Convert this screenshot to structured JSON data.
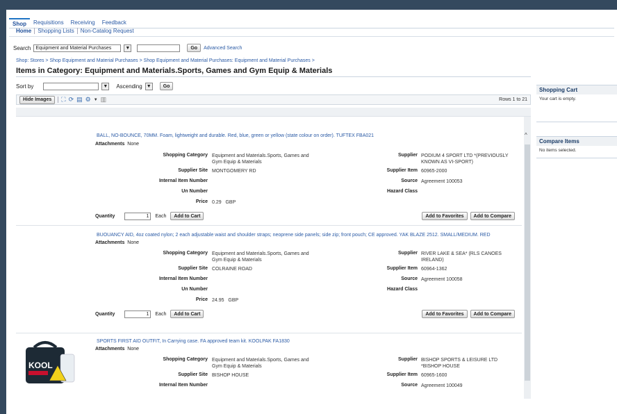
{
  "tabs": [
    "Shop",
    "Requisitions",
    "Receiving",
    "Feedback"
  ],
  "subtabs": [
    "Home",
    "Shopping Lists",
    "Non-Catalog Request"
  ],
  "search": {
    "label": "Search",
    "selected": "Equipment and Material Purchases",
    "go_label": "Go",
    "advanced_label": "Advanced Search"
  },
  "breadcrumb": "Shop: Stores  >  Shop Equipment and Material Purchases  >  Shop Equipment and Material Purchases: Equipment and Material Purchases  >",
  "page_title": "Items in Category: Equipment and Materials.Sports, Games and Gym Equip & Materials",
  "sort": {
    "label": "Sort by",
    "value": "",
    "order": "Ascending",
    "go_label": "Go"
  },
  "toolbar": {
    "hide_images_label": "Hide Images",
    "rows_label": "Rows 1 to 21"
  },
  "labels": {
    "attachments": "Attachments",
    "shopping_category": "Shopping Category",
    "supplier_site": "Supplier Site",
    "internal_item_number": "Internal Item Number",
    "un_number": "Un Number",
    "price": "Price",
    "supplier": "Supplier",
    "supplier_item": "Supplier Item",
    "source": "Source",
    "hazard_class": "Hazard Class",
    "quantity": "Quantity",
    "add_to_cart": "Add to Cart",
    "add_to_favorites": "Add to Favorites",
    "add_to_compare": "Add to Compare"
  },
  "items": [
    {
      "title": "BALL, NO-BOUNCE, 70MM. Foam, lightweight and durable. Red, blue, green or yellow (state colour on order). TUFTEX FBA021",
      "attachments": "None",
      "shopping_category": "Equipment and Materials.Sports, Games and Gym Equip & Materials",
      "supplier_site": "MONTGOMERY RD",
      "price": "0.29",
      "currency": "GBP",
      "supplier": "PODIUM 4 SPORT LTD *(PREVIOUSLY KNOWN AS VI-SPORT)",
      "supplier_item": "60965-2000",
      "source": "Agreement 100053",
      "quantity": "1",
      "uom": "Each"
    },
    {
      "title": "BUOUANCY AID, 4oz coated nylon; 2 each adjustable waist and shoulder straps; neoprene side panels; side zip; front pouch; CE approved. YAK BLAZE 2512. SMALL/MEDIUM. RED",
      "attachments": "None",
      "shopping_category": "Equipment and Materials.Sports, Games and Gym Equip & Materials",
      "supplier_site": "COLRAINE ROAD",
      "price": "24.95",
      "currency": "GBP",
      "supplier": "RIVER LAKE & SEA* (RLS CANOES IRELAND)",
      "supplier_item": "60964-1362",
      "source": "Agreement 100058",
      "quantity": "1",
      "uom": "Each"
    },
    {
      "title": "SPORTS FIRST AID OUTFIT, In Carrying case. FA approved team kit. KOOLPAK FA1830",
      "attachments": "None",
      "shopping_category": "Equipment and Materials.Sports, Games and Gym Equip & Materials",
      "supplier_site": "BISHOP HOUSE",
      "supplier": "BISHOP SPORTS & LEISURE LTD *BISHOP HOUSE",
      "supplier_item": "60965-1600",
      "source": "Agreement 100049",
      "image_text": "KOOL"
    }
  ],
  "cart": {
    "title": "Shopping Cart",
    "body": "Your cart is empty."
  },
  "compare": {
    "title": "Compare Items",
    "body": "No items selected."
  }
}
